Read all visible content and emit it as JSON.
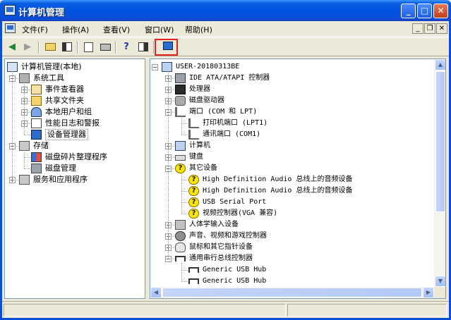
{
  "window": {
    "title": "计算机管理"
  },
  "menu": [
    "文件(F)",
    "操作(A)",
    "查看(V)",
    "窗口(W)",
    "帮助(H)"
  ],
  "mdi_controls": [
    "_",
    "❐",
    "✕"
  ],
  "toolbar_buttons": [
    "back-arrow-icon",
    "forward-arrow-icon",
    "up-folder-icon",
    "show-tree-icon",
    "properties-icon",
    "print-icon",
    "help-icon",
    "show-hide-pane-icon",
    "update-driver-icon"
  ],
  "colors": {
    "title_bar": "#0a4ed8",
    "highlight_box": "#e8201c",
    "selection": "#316ac5"
  },
  "left_tree": [
    {
      "label": "计算机管理(本地)",
      "level": 0,
      "exp": "",
      "icon": "computer-management-icon"
    },
    {
      "label": "系统工具",
      "level": 1,
      "exp": "−",
      "icon": "tools-icon"
    },
    {
      "label": "事件查看器",
      "level": 2,
      "exp": "+",
      "icon": "event-viewer-icon"
    },
    {
      "label": "共享文件夹",
      "level": 2,
      "exp": "+",
      "icon": "shared-folder-icon"
    },
    {
      "label": "本地用户和组",
      "level": 2,
      "exp": "+",
      "icon": "users-icon"
    },
    {
      "label": "性能日志和警报",
      "level": 2,
      "exp": "+",
      "icon": "performance-log-icon"
    },
    {
      "label": "设备管理器",
      "level": 2,
      "exp": "",
      "icon": "device-manager-icon"
    },
    {
      "label": "存储",
      "level": 1,
      "exp": "−",
      "icon": "storage-icon"
    },
    {
      "label": "磁盘碎片整理程序",
      "level": 2,
      "exp": "",
      "icon": "defrag-icon"
    },
    {
      "label": "磁盘管理",
      "level": 2,
      "exp": "",
      "icon": "disk-management-icon"
    },
    {
      "label": "服务和应用程序",
      "level": 1,
      "exp": "+",
      "icon": "services-icon"
    }
  ],
  "device_tree": [
    {
      "label": "USER-20180313BE",
      "level": 0,
      "exp": "−",
      "icon": "computer-icon"
    },
    {
      "label": "IDE ATA/ATAPI 控制器",
      "level": 1,
      "exp": "+",
      "icon": "ide-controller-icon"
    },
    {
      "label": "处理器",
      "level": 1,
      "exp": "+",
      "icon": "processor-icon"
    },
    {
      "label": "磁盘驱动器",
      "level": 1,
      "exp": "+",
      "icon": "disk-drive-icon"
    },
    {
      "label": "端口 (COM 和 LPT)",
      "level": 1,
      "exp": "−",
      "icon": "port-icon"
    },
    {
      "label": "打印机端口 (LPT1)",
      "level": 2,
      "exp": "",
      "icon": "port-icon"
    },
    {
      "label": "通讯端口 (COM1)",
      "level": 2,
      "exp": "",
      "icon": "port-icon"
    },
    {
      "label": "计算机",
      "level": 1,
      "exp": "+",
      "icon": "computer-icon"
    },
    {
      "label": "键盘",
      "level": 1,
      "exp": "+",
      "icon": "keyboard-icon"
    },
    {
      "label": "其它设备",
      "level": 1,
      "exp": "−",
      "icon": "unknown-device-icon"
    },
    {
      "label": "High Definition Audio 总线上的音频设备",
      "level": 2,
      "exp": "",
      "icon": "unknown-device-icon"
    },
    {
      "label": "High Definition Audio 总线上的音频设备",
      "level": 2,
      "exp": "",
      "icon": "unknown-device-icon"
    },
    {
      "label": "USB Serial Port",
      "level": 2,
      "exp": "",
      "icon": "unknown-device-icon"
    },
    {
      "label": "视频控制器(VGA 兼容)",
      "level": 2,
      "exp": "",
      "icon": "unknown-device-icon"
    },
    {
      "label": "人体学输入设备",
      "level": 1,
      "exp": "+",
      "icon": "hid-icon"
    },
    {
      "label": "声音、视频和游戏控制器",
      "level": 1,
      "exp": "+",
      "icon": "sound-icon"
    },
    {
      "label": "鼠标和其它指针设备",
      "level": 1,
      "exp": "+",
      "icon": "mouse-icon"
    },
    {
      "label": "通用串行总线控制器",
      "level": 1,
      "exp": "−",
      "icon": "usb-icon"
    },
    {
      "label": "Generic USB Hub",
      "level": 2,
      "exp": "",
      "icon": "usb-icon"
    },
    {
      "label": "Generic USB Hub",
      "level": 2,
      "exp": "",
      "icon": "usb-icon"
    }
  ]
}
